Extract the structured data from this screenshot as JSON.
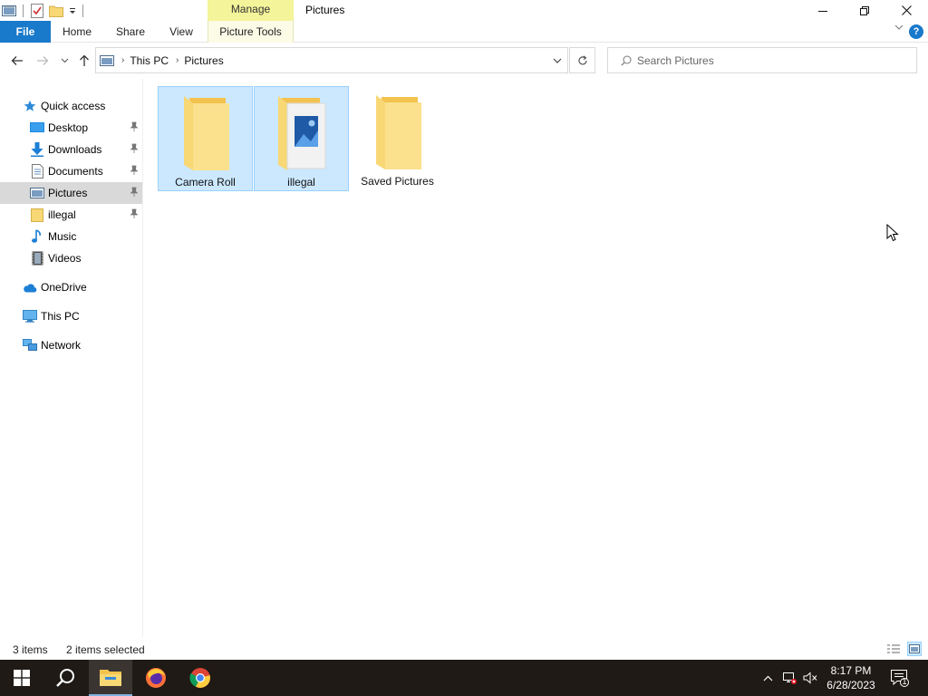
{
  "window": {
    "title": "Pictures",
    "contextual_group": "Manage"
  },
  "ribbon": {
    "file": "File",
    "home": "Home",
    "share": "Share",
    "view": "View",
    "picture_tools": "Picture Tools"
  },
  "address": {
    "crumbs": [
      "This PC",
      "Pictures"
    ]
  },
  "search": {
    "placeholder": "Search Pictures"
  },
  "nav": {
    "quick_access": "Quick access",
    "pinned": [
      {
        "label": "Desktop",
        "icon": "desktop-icon"
      },
      {
        "label": "Downloads",
        "icon": "download-arrow-icon"
      },
      {
        "label": "Documents",
        "icon": "document-icon"
      },
      {
        "label": "Pictures",
        "icon": "pictures-icon"
      },
      {
        "label": "illegal",
        "icon": "folder-icon"
      },
      {
        "label": "Music",
        "icon": "music-note-icon"
      },
      {
        "label": "Videos",
        "icon": "film-icon"
      }
    ],
    "onedrive": "OneDrive",
    "this_pc": "This PC",
    "network": "Network"
  },
  "items": [
    {
      "name": "Camera Roll",
      "selected": true
    },
    {
      "name": "illegal",
      "selected": true
    },
    {
      "name": "Saved Pictures",
      "selected": false
    }
  ],
  "status": {
    "count": "3 items",
    "selection": "2 items selected"
  },
  "taskbar": {
    "apps": [
      "start-icon",
      "search-icon",
      "file-explorer-icon",
      "firefox-icon",
      "chrome-icon"
    ],
    "time": "8:17 PM",
    "date": "6/28/2023",
    "notification_count": "1"
  },
  "colors": {
    "selection": "#cce8ff",
    "selection_border": "#99d1ff",
    "file_tab": "#1979ca",
    "manage_tab": "#f4f49a",
    "folder": "#f8d775"
  }
}
